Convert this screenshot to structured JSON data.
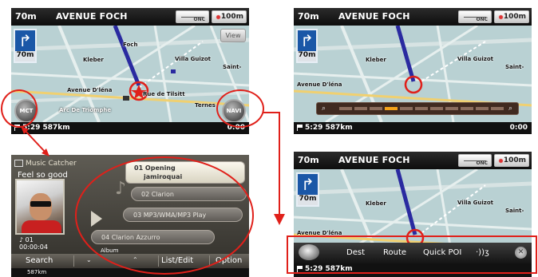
{
  "nav_common": {
    "distance": "70m",
    "street": "AVENUE FOCH",
    "scale": "100m",
    "compass_label": "ONC",
    "status": "5:29  587km",
    "clock": "0:00",
    "turn_distance": "70m"
  },
  "panel_main": {
    "view_button": "View",
    "mct_button": "MCT",
    "navi_button": "NAVI",
    "map_labels": [
      "Foch",
      "Villa Guizot",
      "Saint-",
      "Rue de Tilsitt",
      "Avenue D'léna",
      "Arc De Triomphe",
      "Kleber",
      "Ternes"
    ]
  },
  "panel_zoom": {
    "map_labels": [
      "Villa Guizot",
      "Saint-",
      "Avenue D'léna",
      "Kleber"
    ],
    "zoom_level": 0.45
  },
  "panel_menu": {
    "map_labels": [
      "Villa Guizot",
      "Saint-",
      "Avenue D'léna",
      "Kleber"
    ],
    "items": [
      "Dest",
      "Route",
      "Quick POI"
    ],
    "close": "✕"
  },
  "music": {
    "app_title": "Music Catcher",
    "song_title": "Feel so good",
    "track_number": "♪ 01",
    "track_time": "00:00:04",
    "selected_track": {
      "line1": "01  Opening",
      "line2": "jamiroquai"
    },
    "tracks": [
      "02 Clarion",
      "03 MP3/WMA/MP3 Play",
      "04 Clarion Azzurro"
    ],
    "search_label": "Search",
    "album_label": "Album",
    "list_edit_label": "List/Edit",
    "option_label": "Option",
    "footer": "587km"
  },
  "colors": {
    "highlight_circle": "#e0201a",
    "turn_sign": "#1a57a7",
    "zoom_active": "#f5a31a"
  },
  "icons": [
    "turn-right-arrow-icon",
    "scale-icon",
    "compass-icon",
    "flag-icon",
    "target-icon",
    "music-note-icon",
    "disc-icon",
    "close-icon",
    "voice-icon"
  ]
}
